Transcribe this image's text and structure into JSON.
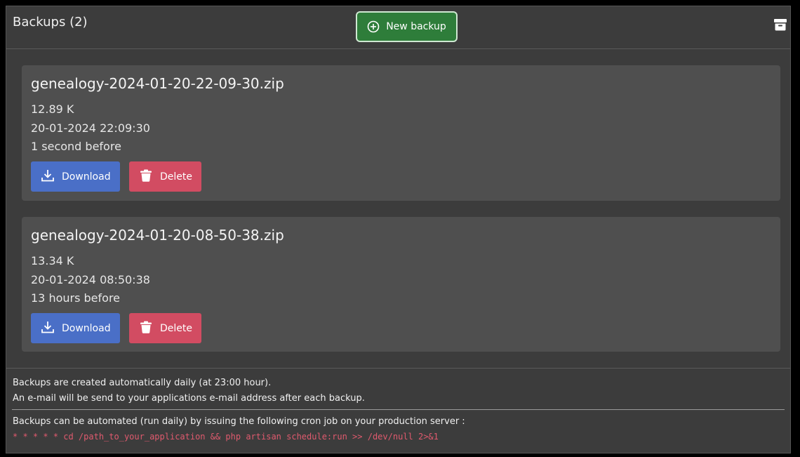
{
  "header": {
    "title": "Backups (2)",
    "new_backup_label": "New backup"
  },
  "backups": [
    {
      "filename": "genealogy-2024-01-20-22-09-30.zip",
      "size": "12.89 K",
      "datetime": "20-01-2024 22:09:30",
      "age": "1 second before",
      "download_label": "Download",
      "delete_label": "Delete"
    },
    {
      "filename": "genealogy-2024-01-20-08-50-38.zip",
      "size": "13.34 K",
      "datetime": "20-01-2024 08:50:38",
      "age": "13 hours before",
      "download_label": "Download",
      "delete_label": "Delete"
    }
  ],
  "footer": {
    "note_daily": "Backups are created automatically daily (at 23:00 hour).",
    "note_email": "An e-mail will be send to your applications e-mail address after each backup.",
    "note_cron": "Backups can be automated (run daily) by issuing the following cron job on your production server :",
    "cron_command": "* * * * * cd /path_to_your_application && php artisan schedule:run >> /dev/null 2>&1"
  },
  "icons": {
    "new_backup": "plus-circle-icon",
    "archive": "archive-icon",
    "download": "download-icon",
    "delete": "trash-icon"
  },
  "colors": {
    "new_backup_bg": "#2e7d3a",
    "download_bg": "#4a6fc7",
    "delete_bg": "#d24c62",
    "cron_text": "#e05a6e",
    "card_bg": "#4f4f4f",
    "panel_bg": "#3c3c3c"
  }
}
